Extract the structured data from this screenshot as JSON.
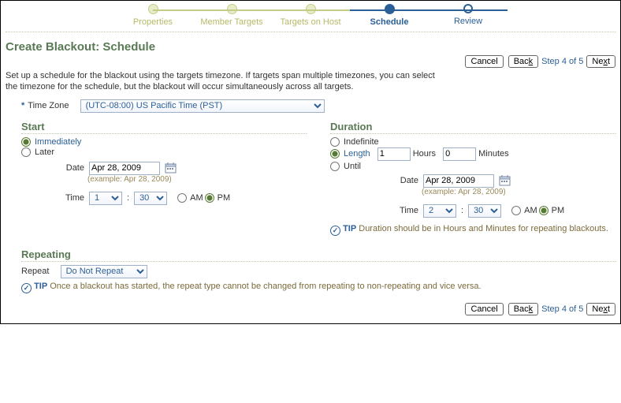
{
  "train": {
    "steps": [
      "Properties",
      "Member Targets",
      "Targets on Host",
      "Schedule",
      "Review"
    ],
    "activeIndex": 3
  },
  "page": {
    "title": "Create Blackout: Schedule",
    "intro": "Set up a schedule for the blackout using the targets timezone. If targets span multiple timezones, you can select the timezone for the schedule, but the blackout will occur simultaneously across all targets.",
    "stepIndicator": "Step 4 of 5"
  },
  "nav": {
    "cancel": "Cancel",
    "back": "Back",
    "next": "Next"
  },
  "timezone": {
    "label": "Time Zone",
    "value": "(UTC-08:00) US Pacific Time (PST)"
  },
  "start": {
    "legend": "Start",
    "opt_immediately": "Immediately",
    "opt_later": "Later",
    "selected": "immediately",
    "date_label": "Date",
    "date_value": "Apr 28, 2009",
    "date_example": "(example: Apr 28, 2009)",
    "time_label": "Time",
    "time_hour": "1",
    "time_min": "30",
    "am": "AM",
    "pm": "PM",
    "ampm_selected": "PM"
  },
  "duration": {
    "legend": "Duration",
    "opt_indefinite": "Indefinite",
    "opt_length": "Length",
    "opt_until": "Until",
    "selected": "length",
    "hours_value": "1",
    "hours_label": "Hours",
    "mins_value": "0",
    "mins_label": "Minutes",
    "date_label": "Date",
    "date_value": "Apr 28, 2009",
    "date_example": "(example: Apr 28, 2009)",
    "time_label": "Time",
    "time_hour": "2",
    "time_min": "30",
    "am": "AM",
    "pm": "PM",
    "ampm_selected": "PM",
    "tip_label": "TIP",
    "tip_text": "Duration should be in Hours and Minutes for repeating blackouts."
  },
  "repeating": {
    "legend": "Repeating",
    "repeat_label": "Repeat",
    "repeat_value": "Do Not Repeat",
    "tip_label": "TIP",
    "tip_text": "Once a blackout has started, the repeat type cannot be changed from repeating to non-repeating and vice versa."
  }
}
